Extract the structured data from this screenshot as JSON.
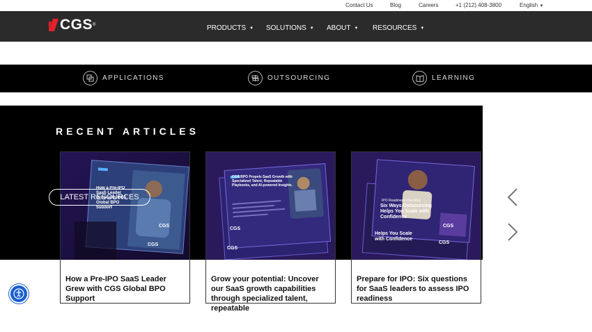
{
  "utility": {
    "contact": "Contact Us",
    "blog": "Blog",
    "careers": "Careers",
    "phone": "+1 (212) 408-3800",
    "language": "English"
  },
  "brand": {
    "name": "CGS",
    "reg": "®"
  },
  "nav": [
    {
      "label": "PRODUCTS"
    },
    {
      "label": "SOLUTIONS"
    },
    {
      "label": "ABOUT"
    },
    {
      "label": "RESOURCES"
    }
  ],
  "categories": [
    {
      "label": "APPLICATIONS",
      "icon": "applications-icon"
    },
    {
      "label": "OUTSOURCING",
      "icon": "outsourcing-icon"
    },
    {
      "label": "LEARNING",
      "icon": "learning-icon"
    }
  ],
  "recent": {
    "title": "RECENT ARTICLES",
    "latest_button": "LATEST RESOURCES"
  },
  "articles": [
    {
      "caption": "How a Pre-IPO SaaS Leader Grew with CGS Global BPO Support",
      "thumb_text": "How a Pre-IPO SaaS Leader Grew with CGS Global BPO Support",
      "thumb_brand": "CGS"
    },
    {
      "caption": "Grow your potential: Uncover our SaaS growth capabilities through specialized talent, repeatable",
      "thumb_text": "CGS BPO Propels SaaS Growth with Specialized Talent, Repeatable Playbooks, and AI-powered Insights.",
      "thumb_brand": "CGS"
    },
    {
      "caption": "Prepare for IPO: Six questions for SaaS leaders to assess IPO readiness",
      "thumb_text": "Six Ways Outsourcing Helps You Scale with Confidence",
      "thumb_kicker": "IPO Readiness Checklist:",
      "thumb_back": "Helps You Scale with Confidence",
      "thumb_brand": "CGS"
    }
  ],
  "colors": {
    "nav_bg": "#2b2b2b",
    "brand_red": "#e4202a",
    "accessibility_blue": "#1a5fcf"
  }
}
